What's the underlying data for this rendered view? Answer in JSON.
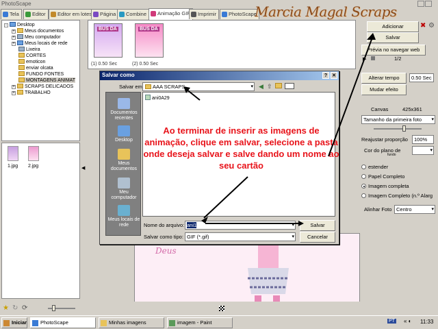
{
  "window": {
    "title": "PhotoScape"
  },
  "brand": "Marcia Magal Scraps",
  "tabs": [
    {
      "label": "Tela",
      "color": "#3a7bd5"
    },
    {
      "label": "Editor",
      "color": "#3a9a3a"
    },
    {
      "label": "Editor em lotes",
      "color": "#c28a2a"
    },
    {
      "label": "Página",
      "color": "#7a4ac2"
    },
    {
      "label": "Combine",
      "color": "#2a9ac2"
    },
    {
      "label": "Animação GIF",
      "color": "#d03a7a"
    },
    {
      "label": "Imprimir",
      "color": "#555555"
    },
    {
      "label": "PhotoScape",
      "color": "#3a7bd5"
    }
  ],
  "tree": {
    "items": [
      {
        "label": "Desktop",
        "expand": "-"
      },
      {
        "label": "Meus documentos",
        "expand": "+"
      },
      {
        "label": "Meu computador",
        "expand": "+"
      },
      {
        "label": "Meus locais de rede",
        "expand": "+"
      },
      {
        "label": "Lixeira",
        "expand": ""
      },
      {
        "label": "CORTES",
        "expand": ""
      },
      {
        "label": "emoticon",
        "expand": ""
      },
      {
        "label": "enviar olcata",
        "expand": ""
      },
      {
        "label": "FUNDO FONTES",
        "expand": ""
      },
      {
        "label": "MONTAGENS ANIMAT",
        "expand": ""
      },
      {
        "label": "SCRAPS DELICADOS",
        "expand": "+"
      },
      {
        "label": "TRABALHO",
        "expand": "+"
      }
    ]
  },
  "thumbs": [
    {
      "label": "1.jpg"
    },
    {
      "label": "2.jpg"
    }
  ],
  "frames": [
    {
      "badge": "BUS DA",
      "caption": "(1) 0.50 Sec"
    },
    {
      "badge": "BUS DA",
      "caption": "(2) 0.50 Sec"
    }
  ],
  "right": {
    "add": "Adicionar",
    "save": "Salvar",
    "preview": "Prévia no navegar web",
    "page": "1/2",
    "change_time": "Alterar tempo",
    "time_value": "0.50 Sec",
    "change_effect": "Mudar efeito",
    "canvas_label": "Canvas",
    "canvas_size": "425x361",
    "size_option": "Tamanho da primeira foto",
    "resize_label": "Reajustar proporção",
    "resize_value": "100%",
    "bg_label": "Cor do plano de",
    "bg_label2": "fundo",
    "opt1": "estender",
    "opt2": "Papel Completo",
    "opt3": "Imagem completa",
    "opt4": "Imagem Completo (n.º Alarg",
    "align_label": "Alinhar Foto",
    "align_value": "Centro"
  },
  "dialog": {
    "title": "Salvar como",
    "save_in_label": "Salvar em:",
    "save_in_value": "AAA SCRAPS",
    "file_item": "ani0A29",
    "places": [
      "Documentos recentes",
      "Desktop",
      "Meus documentos",
      "Meu computador",
      "Meus locais de rede"
    ],
    "filename_label": "Nome do arquivo:",
    "filename_value": "ani1",
    "type_label": "Salvar como tipo:",
    "type_value": "GIF (*.gif)",
    "save_btn": "Salvar",
    "cancel_btn": "Cancelar"
  },
  "callout": "Ao terminar de inserir as imagens de animação, clique em salvar, selecione a pasta onde deseja salvar e salve dando um nome ao seu cartão",
  "preview": {
    "text": "Deus"
  },
  "taskbar": {
    "start": "Iniciar",
    "items": [
      "PhotoScape",
      "Minhas imagens",
      "imagem - Paint"
    ],
    "lang": "PT",
    "clock": "11:33"
  }
}
